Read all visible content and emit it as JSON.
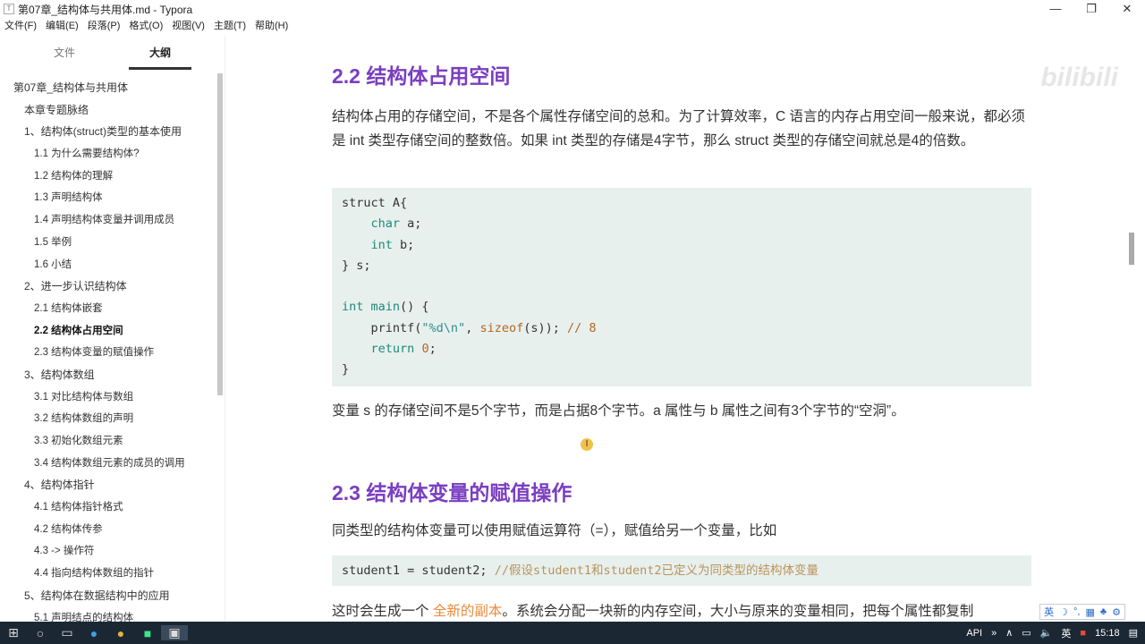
{
  "window": {
    "title": "第07章_结构体与共用体.md - Typora",
    "app_icon": "T",
    "min": "—",
    "max": "❐",
    "close": "✕"
  },
  "menu": [
    "文件(F)",
    "编辑(E)",
    "段落(P)",
    "格式(O)",
    "视图(V)",
    "主题(T)",
    "帮助(H)"
  ],
  "sidebar": {
    "tabs": [
      "文件",
      "大纲"
    ],
    "items": [
      {
        "t": "第07章_结构体与共用体",
        "l": 0
      },
      {
        "t": "本章专题脉络",
        "l": 1
      },
      {
        "t": "1、结构体(struct)类型的基本使用",
        "l": 1
      },
      {
        "t": "1.1 为什么需要结构体?",
        "l": 2
      },
      {
        "t": "1.2 结构体的理解",
        "l": 2
      },
      {
        "t": "1.3 声明结构体",
        "l": 2
      },
      {
        "t": "1.4 声明结构体变量并调用成员",
        "l": 2
      },
      {
        "t": "1.5 举例",
        "l": 2
      },
      {
        "t": "1.6 小结",
        "l": 2
      },
      {
        "t": "2、进一步认识结构体",
        "l": 1
      },
      {
        "t": "2.1 结构体嵌套",
        "l": 2
      },
      {
        "t": "2.2 结构体占用空间",
        "l": 2,
        "active": true
      },
      {
        "t": "2.3 结构体变量的赋值操作",
        "l": 2
      },
      {
        "t": "3、结构体数组",
        "l": 1
      },
      {
        "t": "3.1 对比结构体与数组",
        "l": 2
      },
      {
        "t": "3.2 结构体数组的声明",
        "l": 2
      },
      {
        "t": "3.3 初始化数组元素",
        "l": 2
      },
      {
        "t": "3.4 结构体数组元素的成员的调用",
        "l": 2
      },
      {
        "t": "4、结构体指针",
        "l": 1
      },
      {
        "t": "4.1 结构体指针格式",
        "l": 2
      },
      {
        "t": "4.2 结构体传参",
        "l": 2
      },
      {
        "t": "4.3 -> 操作符",
        "l": 2
      },
      {
        "t": "4.4 指向结构体数组的指针",
        "l": 2
      },
      {
        "t": "5、结构体在数据结构中的应用",
        "l": 1
      },
      {
        "t": "5.1 声明结点的结构体",
        "l": 2
      }
    ],
    "footer": {
      "back": "‹",
      "source": "</>"
    }
  },
  "main": {
    "h22": "2.2 结构体占用空间",
    "p1": "结构体占用的存储空间，不是各个属性存储空间的总和。为了计算效率，C 语言的内存占用空间一般来说，都必须是 int 类型存储空间的整数倍。如果 int 类型的存储是4字节，那么 struct 类型的存储空间就总是4的倍数。",
    "code1": [
      [
        [
          "struct A{",
          ""
        ]
      ],
      [
        [
          "    ",
          ""
        ],
        [
          "char",
          "kw"
        ],
        [
          " a;",
          ""
        ]
      ],
      [
        [
          "    ",
          ""
        ],
        [
          "int",
          "kw"
        ],
        [
          " b;",
          ""
        ]
      ],
      [
        [
          "} s;",
          ""
        ]
      ],
      [
        [
          "",
          ""
        ]
      ],
      [
        [
          "int",
          "kw"
        ],
        [
          " ",
          ""
        ],
        [
          "main",
          "kw"
        ],
        [
          "() {",
          ""
        ]
      ],
      [
        [
          "    printf(",
          ""
        ],
        [
          "\"%d\\n\"",
          "str"
        ],
        [
          ", ",
          ""
        ],
        [
          "sizeof",
          "fn"
        ],
        [
          "(s)); ",
          ""
        ],
        [
          "// 8",
          "num"
        ]
      ],
      [
        [
          "    ",
          ""
        ],
        [
          "return",
          "kw"
        ],
        [
          " ",
          ""
        ],
        [
          "0",
          "num"
        ],
        [
          ";",
          ""
        ]
      ],
      [
        [
          "}",
          ""
        ]
      ]
    ],
    "p2": "变量 s 的存储空间不是5个字节，而是占据8个字节。a 属性与 b 属性之间有3个字节的“空洞”。",
    "h23": "2.3 结构体变量的赋值操作",
    "p3": "同类型的结构体变量可以使用赋值运算符（=），赋值给另一个变量，比如",
    "code2": [
      [
        [
          "student1 = student2; ",
          ""
        ],
        [
          "//假设student1和student2已定义为同类型的结构体变量",
          "cm"
        ]
      ]
    ],
    "p4a": "这时会生成一个 ",
    "p4hl": "全新的副本",
    "p4b": "。系统会分配一块新的内存空间，大小与原来的变量相同，把每个属性都复制",
    "cursor": "I"
  },
  "watermark": "bilibili",
  "ime": [
    "英",
    "☽",
    "°,",
    "▦",
    "♣",
    "⚙"
  ],
  "taskbar": {
    "api": "API",
    "chev": "»",
    "up": "∧",
    "lang": "英",
    "time": "15:18"
  }
}
